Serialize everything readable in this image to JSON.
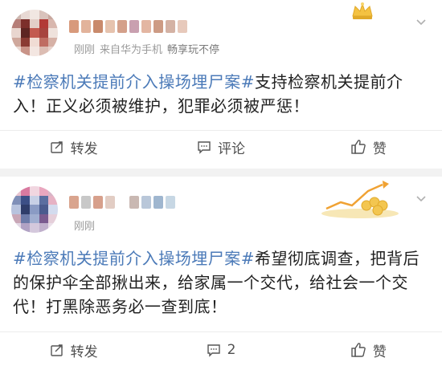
{
  "posts": [
    {
      "meta": {
        "time": "刚刚",
        "source_prefix": "来自华为手机",
        "app": "畅享玩不停"
      },
      "content": {
        "hashtag": "#检察机关提前介入操场埋尸案#",
        "text": "支持检察机关提前介入！正义必须被维护，犯罪必须被严惩！"
      },
      "actions": {
        "repost": "转发",
        "comment": "评论",
        "like": "赞"
      }
    },
    {
      "meta": {
        "time": "刚刚"
      },
      "content": {
        "hashtag": "#检察机关提前介入操场埋尸案#",
        "text": "希望彻底调查，把背后的保护伞全部揪出来，给家属一个交代，给社会一个交代！打黑除恶务必一查到底！"
      },
      "actions": {
        "repost": "转发",
        "comment": "2",
        "like": "赞"
      }
    }
  ],
  "colors": {
    "hashtag": "#4b7ab8",
    "text": "#222222",
    "meta": "#9a9a9a",
    "separator": "#f2f2f2"
  },
  "icons": [
    "repost-icon",
    "comment-icon",
    "like-icon",
    "chevron-down-icon",
    "crown-badge-icon",
    "growth-chart-badge-icon"
  ]
}
